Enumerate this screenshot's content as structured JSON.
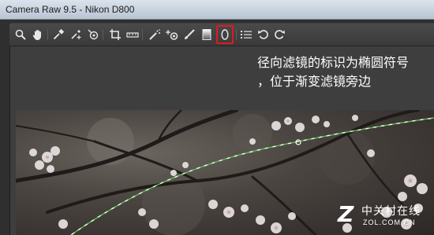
{
  "window": {
    "title": "Camera Raw 9.5  -  Nikon D800"
  },
  "toolbar": {
    "tools": [
      {
        "name": "zoom-tool",
        "icon": "magnifier"
      },
      {
        "name": "hand-tool",
        "icon": "hand"
      },
      {
        "name": "white-balance-tool",
        "icon": "eyedropper"
      },
      {
        "name": "color-sampler-tool",
        "icon": "eyedropper-plus"
      },
      {
        "name": "targeted-adjustment-tool",
        "icon": "target"
      },
      {
        "name": "crop-tool",
        "icon": "crop"
      },
      {
        "name": "straighten-tool",
        "icon": "level"
      },
      {
        "name": "spot-removal-tool",
        "icon": "brush-spot"
      },
      {
        "name": "red-eye-tool",
        "icon": "eye-plus"
      },
      {
        "name": "adjustment-brush-tool",
        "icon": "brush"
      },
      {
        "name": "graduated-filter-tool",
        "icon": "gradient-rect"
      },
      {
        "name": "radial-filter-tool",
        "icon": "ellipse"
      },
      {
        "name": "preferences-button",
        "icon": "list"
      },
      {
        "name": "rotate-left-button",
        "icon": "rotate-ccw"
      },
      {
        "name": "rotate-right-button",
        "icon": "rotate-cw"
      }
    ],
    "highlight_color": "#e0191f"
  },
  "caption": {
    "line1": "径向滤镜的标识为椭圆符号",
    "line2": "，位于渐变滤镜旁边"
  },
  "watermark": {
    "main": "中关村在线",
    "sub": "ZOL.COM.CN"
  }
}
